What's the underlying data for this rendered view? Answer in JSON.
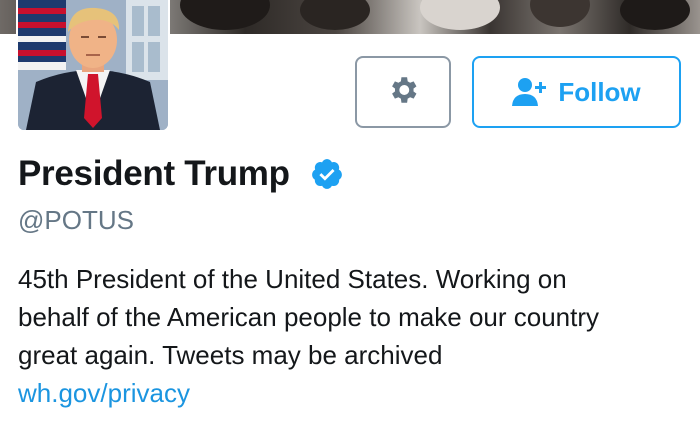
{
  "profile": {
    "display_name": "President Trump",
    "handle": "@POTUS",
    "verified": true,
    "bio_lines": [
      "45th President of the United States. Working on",
      "behalf of the American people to make our country",
      "great again. Tweets may be archived"
    ],
    "bio_link": "wh.gov/privacy"
  },
  "actions": {
    "settings_icon": "gear-icon",
    "follow_icon": "add-user-icon",
    "follow_label": "Follow"
  },
  "colors": {
    "accent": "#1da1f2",
    "link": "#1b95e0",
    "muted_text": "#657786",
    "primary_text": "#14171a",
    "settings_border": "#8b98a5"
  }
}
